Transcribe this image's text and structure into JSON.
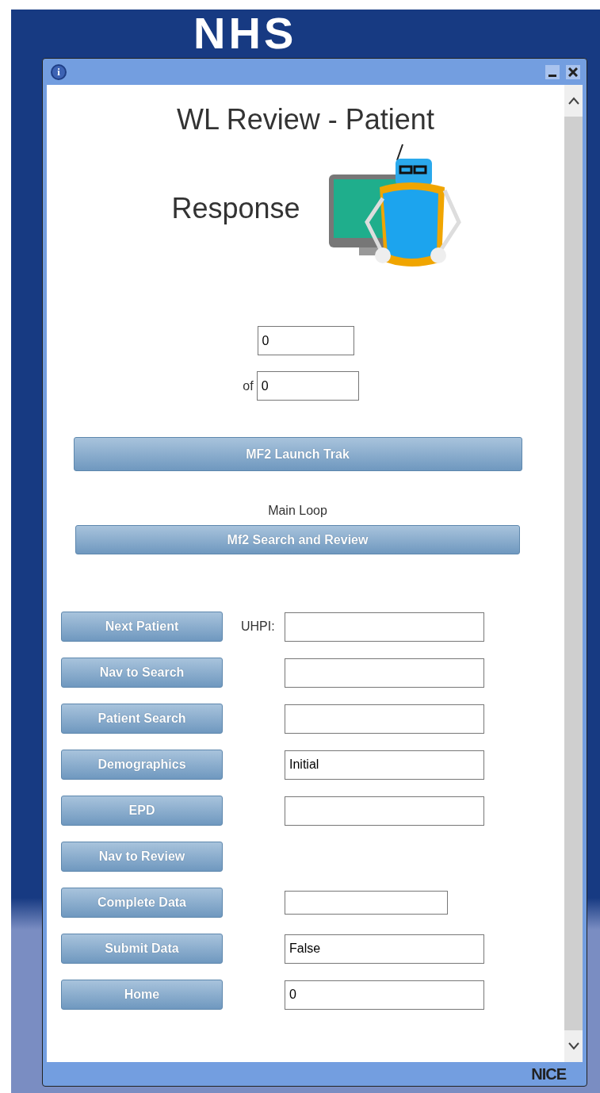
{
  "background": {
    "logo": "NHS"
  },
  "window": {
    "title_bar": {
      "info": "i"
    },
    "footer": {
      "brand": "NICE"
    }
  },
  "header": {
    "title": "WL Review - Patient",
    "subtitle": "Response"
  },
  "counter": {
    "current": "0",
    "of_label": "of",
    "total": "0"
  },
  "launch_button": "MF2 Launch Trak",
  "main_loop": {
    "label": "Main Loop",
    "button": "Mf2 Search and Review"
  },
  "steps": [
    {
      "button": "Next Patient",
      "label": "UHPI:",
      "field": {
        "kind": "long"
      }
    },
    {
      "button": "Nav to Search",
      "field": {
        "kind": "long"
      }
    },
    {
      "button": "Patient Search",
      "field": {
        "kind": "long"
      }
    },
    {
      "button": "Demographics",
      "field": {
        "value": "Initial"
      }
    },
    {
      "button": "EPD",
      "field": {
        "kind": "long"
      }
    },
    {
      "button": "Nav to Review"
    },
    {
      "button": "Complete Data",
      "field": {
        "kind": "short"
      }
    },
    {
      "button": "Submit Data",
      "field": {
        "value": "False"
      }
    },
    {
      "button": "Home",
      "field": {
        "value": "0"
      }
    }
  ]
}
